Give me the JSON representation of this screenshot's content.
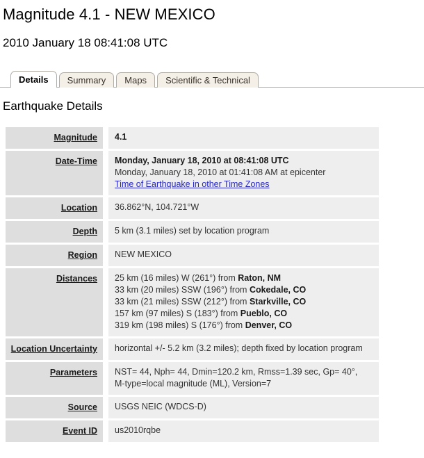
{
  "header": {
    "title": "Magnitude 4.1 - NEW MEXICO",
    "subtitle": "2010 January 18 08:41:08 UTC"
  },
  "tabs": [
    {
      "label": "Details",
      "active": true
    },
    {
      "label": "Summary",
      "active": false
    },
    {
      "label": "Maps",
      "active": false
    },
    {
      "label": "Scientific & Technical",
      "active": false
    }
  ],
  "section": {
    "title": "Earthquake Details"
  },
  "details": {
    "magnitude": {
      "label": "Magnitude",
      "value": "4.1"
    },
    "date_time": {
      "label": "Date-Time",
      "utc": "Monday, January 18, 2010 at 08:41:08 UTC",
      "local": "Monday, January 18, 2010 at 01:41:08 AM at epicenter",
      "link": "Time of Earthquake in other Time Zones"
    },
    "location": {
      "label": "Location",
      "value": "36.862°N, 104.721°W"
    },
    "depth": {
      "label": "Depth",
      "value": "5 km (3.1 miles) set by location program"
    },
    "region": {
      "label": "Region",
      "value": "NEW MEXICO"
    },
    "distances": {
      "label": "Distances",
      "items": [
        {
          "measure": "25 km (16 miles) W (261°) from ",
          "place": "Raton, NM"
        },
        {
          "measure": "33 km (20 miles) SSW (196°) from ",
          "place": "Cokedale, CO"
        },
        {
          "measure": "33 km (21 miles) SSW (212°) from ",
          "place": "Starkville, CO"
        },
        {
          "measure": "157 km (97 miles) S (183°) from ",
          "place": "Pueblo, CO"
        },
        {
          "measure": "319 km (198 miles) S (176°) from ",
          "place": "Denver, CO"
        }
      ]
    },
    "location_uncertainty": {
      "label": "Location Uncertainty",
      "value": "horizontal +/- 5.2 km (3.2 miles); depth fixed by location program"
    },
    "parameters": {
      "label": "Parameters",
      "line1": "NST= 44, Nph= 44, Dmin=120.2 km, Rmss=1.39 sec, Gp= 40°,",
      "line2": "M-type=local magnitude (ML), Version=7"
    },
    "source": {
      "label": "Source",
      "value": "USGS NEIC (WDCS-D)"
    },
    "event_id": {
      "label": "Event ID",
      "value": "us2010rqbe"
    }
  },
  "colors": {
    "label_bg": "#dedede",
    "value_bg": "#eeeeee",
    "tab_inactive_bg": "#f4f0e8",
    "tab_border": "#b0aca4",
    "link": "#2727c8"
  }
}
